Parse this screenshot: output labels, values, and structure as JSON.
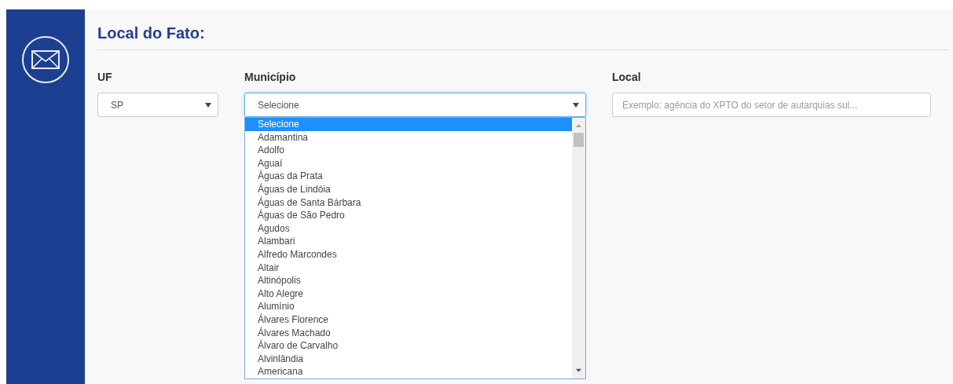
{
  "section": {
    "title": "Local do Fato:"
  },
  "fields": [
    {
      "kind": "select",
      "label": "UF",
      "value": "SP",
      "focused": false
    },
    {
      "kind": "select",
      "label": "Município",
      "value": "Selecione",
      "focused": true,
      "options": [
        {
          "label": "Selecione",
          "selected": true
        },
        {
          "label": "Adamantina",
          "selected": false
        },
        {
          "label": "Adolfo",
          "selected": false
        },
        {
          "label": "Aguaí",
          "selected": false
        },
        {
          "label": "Águas da Prata",
          "selected": false
        },
        {
          "label": "Águas de Lindóia",
          "selected": false
        },
        {
          "label": "Águas de Santa Bárbara",
          "selected": false
        },
        {
          "label": "Águas de São Pedro",
          "selected": false
        },
        {
          "label": "Agudos",
          "selected": false
        },
        {
          "label": "Alambari",
          "selected": false
        },
        {
          "label": "Alfredo Marcondes",
          "selected": false
        },
        {
          "label": "Altair",
          "selected": false
        },
        {
          "label": "Altinópolis",
          "selected": false
        },
        {
          "label": "Alto Alegre",
          "selected": false
        },
        {
          "label": "Alumínio",
          "selected": false
        },
        {
          "label": "Álvares Florence",
          "selected": false
        },
        {
          "label": "Álvares Machado",
          "selected": false
        },
        {
          "label": "Álvaro de Carvalho",
          "selected": false
        },
        {
          "label": "Alvinlândia",
          "selected": false
        },
        {
          "label": "Americana",
          "selected": false
        }
      ]
    },
    {
      "kind": "text",
      "label": "Local",
      "placeholder": "Exemplo: agência do XPTO do setor de autarquias sul..."
    }
  ]
}
